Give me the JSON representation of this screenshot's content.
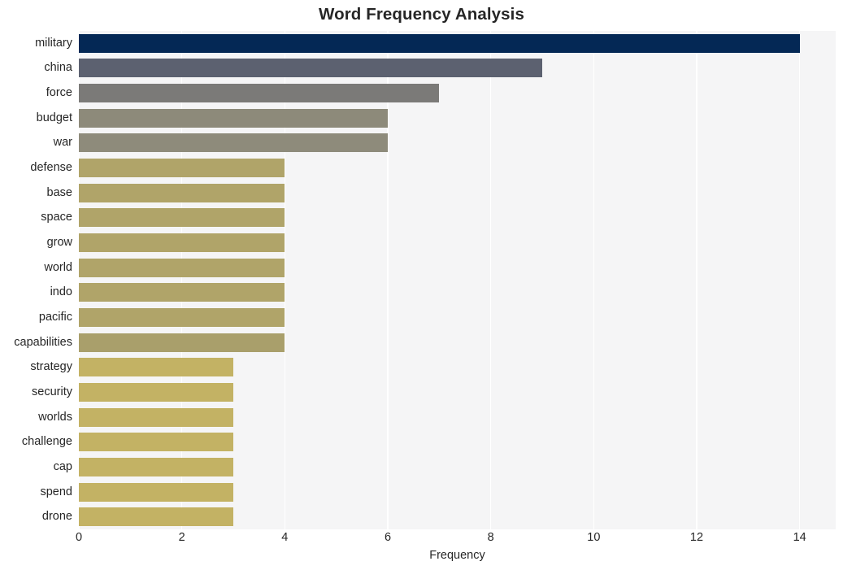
{
  "chart_data": {
    "type": "bar",
    "orientation": "horizontal",
    "title": "Word Frequency Analysis",
    "xlabel": "Frequency",
    "ylabel": "",
    "xlim": [
      0,
      14.7
    ],
    "ylim": [
      0,
      19
    ],
    "grid": true,
    "legend": null,
    "xticks": [
      "0",
      "2",
      "4",
      "6",
      "8",
      "10",
      "12",
      "14"
    ],
    "xtick_values": [
      0,
      2,
      4,
      6,
      8,
      10,
      12,
      14
    ],
    "categories": [
      "military",
      "china",
      "force",
      "budget",
      "war",
      "defense",
      "base",
      "space",
      "grow",
      "world",
      "indo",
      "pacific",
      "capabilities",
      "strategy",
      "security",
      "worlds",
      "challenge",
      "cap",
      "spend",
      "drone"
    ],
    "values": [
      14,
      9,
      7,
      6,
      6,
      4,
      4,
      4,
      4,
      4,
      4,
      4,
      4,
      3,
      3,
      3,
      3,
      3,
      3,
      3
    ],
    "bar_colors": [
      "#042855",
      "#5c6170",
      "#7b7a78",
      "#8d8a7a",
      "#8e8b7b",
      "#b0a469",
      "#b0a469",
      "#b0a469",
      "#b0a469",
      "#b0a469",
      "#b0a469",
      "#b0a469",
      "#a99f6b",
      "#c3b264",
      "#c3b264",
      "#c3b264",
      "#c3b264",
      "#c3b264",
      "#c3b264",
      "#c3b264"
    ],
    "plot_background": "#f5f5f6",
    "gridline_color": "#ffffff",
    "figure_background": "#ffffff",
    "text_color": "#262626"
  }
}
